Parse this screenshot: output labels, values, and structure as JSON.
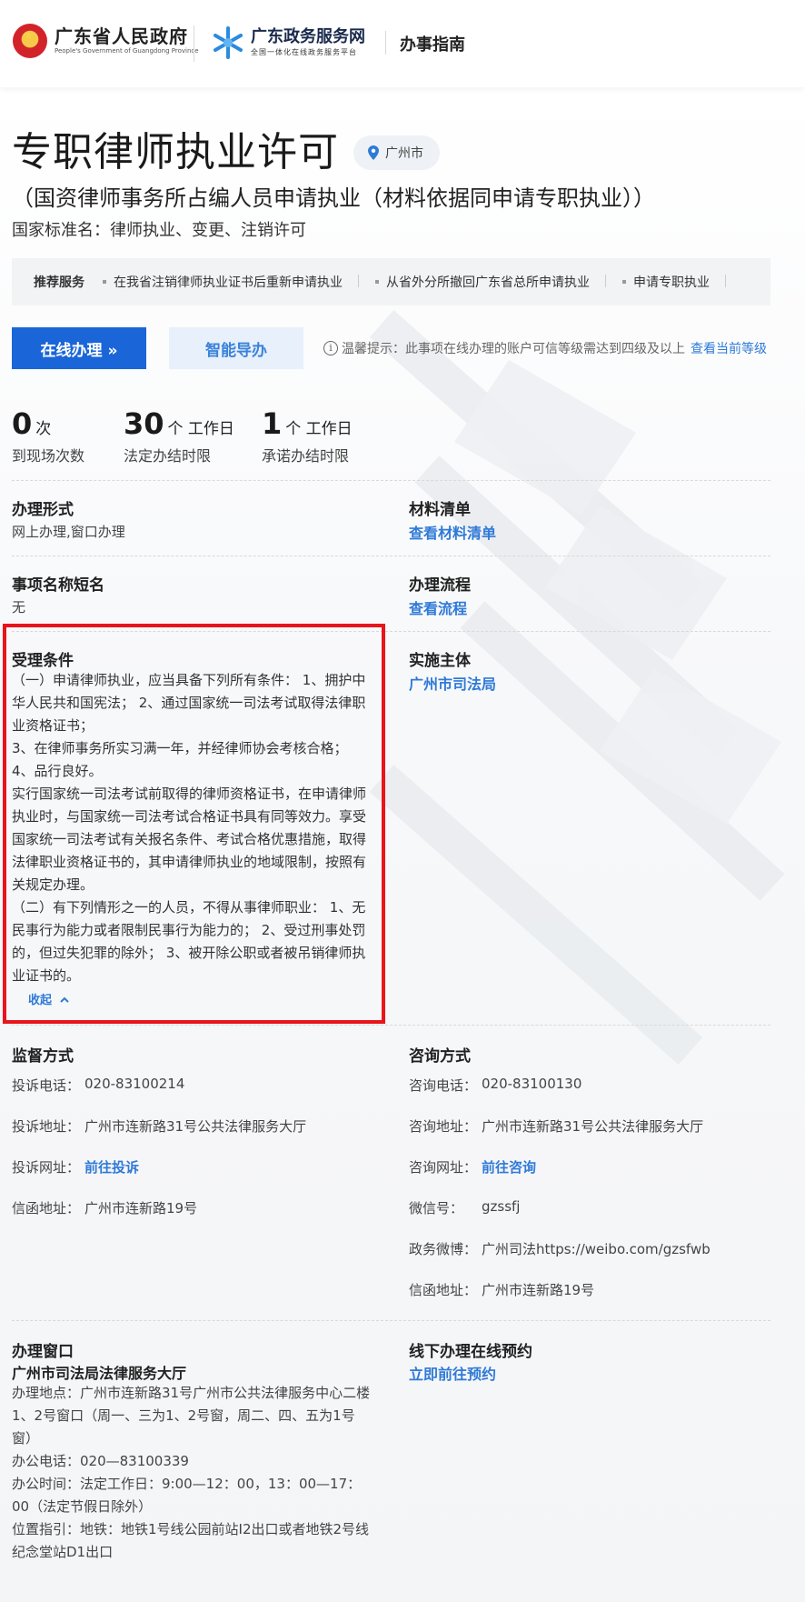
{
  "header": {
    "gov_name": "广东省人民政府",
    "gov_name_en": "People's Government of Guangdong Province",
    "portal_name": "广东政务服务网",
    "portal_sub": "全国一体化在线政务服务平台",
    "guide_label": "办事指南"
  },
  "item": {
    "title": "专职律师执业许可",
    "location": "广州市",
    "subtitle": "（国资律师事务所占编人员申请执业（材料依据同申请专职执业））",
    "std_label": "国家标准名：",
    "std_value": "律师执业、变更、注销许可"
  },
  "recommend": {
    "label": "推荐服务",
    "items": [
      "在我省注销律师执业证书后重新申请执业",
      "从省外分所撤回广东省总所申请执业",
      "申请专职执业"
    ]
  },
  "actions": {
    "online_label": "在线办理 »",
    "guide_label": "智能导办",
    "tip_icon": "i",
    "tip_text": "温馨提示：此事项在线办理的账户可信等级需达到四级及以上",
    "tip_link": "查看当前等级"
  },
  "stats": [
    {
      "num": "0",
      "unit": "次",
      "label": "到现场次数"
    },
    {
      "num": "30",
      "unit": "个 工作日",
      "label": "法定办结时限"
    },
    {
      "num": "1",
      "unit": "个 工作日",
      "label": "承诺办结时限"
    }
  ],
  "info": {
    "form_title": "办理形式",
    "form_value": "网上办理,窗口办理",
    "materials_title": "材料清单",
    "materials_link": "查看材料清单",
    "short_name_title": "事项名称短名",
    "short_name_value": "无",
    "process_title": "办理流程",
    "process_link": "查看流程",
    "conditions_title": "受理条件",
    "conditions_text": "（一）申请律师执业，应当具备下列所有条件： 1、拥护中华人民共和国宪法； 2、通过国家统一司法考试取得法律职业资格证书；\n3、在律师事务所实习满一年，并经律师协会考核合格；\n4、品行良好。\n实行国家统一司法考试前取得的律师资格证书，在申请律师执业时，与国家统一司法考试合格证书具有同等效力。享受国家统一司法考试有关报名条件、考试合格优惠措施，取得法律职业资格证书的，其申请律师执业的地域限制，按照有关规定办理。\n（二）有下列情形之一的人员，不得从事律师职业： 1、无民事行为能力或者限制民事行为能力的； 2、受过刑事处罚的，但过失犯罪的除外； 3、被开除公职或者被吊销律师执业证书的。",
    "collapse_label": "收起",
    "impl_title": "实施主体",
    "impl_link": "广州市司法局"
  },
  "supervision": {
    "title": "监督方式",
    "phone_k": "投诉电话：",
    "phone_v": "020-83100214",
    "addr_k": "投诉地址：",
    "addr_v": "广州市连新路31号公共法律服务大厅",
    "web_k": "投诉网址：",
    "web_v": "前往投诉",
    "mail_k": "信函地址：",
    "mail_v": "广州市连新路19号"
  },
  "consult": {
    "title": "咨询方式",
    "phone_k": "咨询电话：",
    "phone_v": "020-83100130",
    "addr_k": "咨询地址：",
    "addr_v": "广州市连新路31号公共法律服务大厅",
    "web_k": "咨询网址：",
    "web_v": "前往咨询",
    "wechat_k": "微信号：",
    "wechat_v": "gzssfj",
    "weibo_k": "政务微博：",
    "weibo_v": "广州司法https://weibo.com/gzsfwb",
    "mail_k": "信函地址：",
    "mail_v": "广州市连新路19号"
  },
  "window": {
    "title": "办理窗口",
    "name": "广州市司法局法律服务大厅",
    "details": "办理地点：广州市连新路31号广州市公共法律服务中心二楼1、2号窗口（周一、三为1、2号窗，周二、四、五为1号窗）\n办公电话：020—83100339\n办公时间：法定工作日：9:00—12：00，13：00—17：00（法定节假日除外）\n位置指引：地铁：地铁1号线公园前站I2出口或者地铁2号线纪念堂站D1出口"
  },
  "offline": {
    "title": "线下办理在线预约",
    "link": "立即前往预约"
  },
  "colors": {
    "primary": "#1a66d8",
    "link": "#2f7ad7",
    "highlight_border": "#e8151b"
  }
}
